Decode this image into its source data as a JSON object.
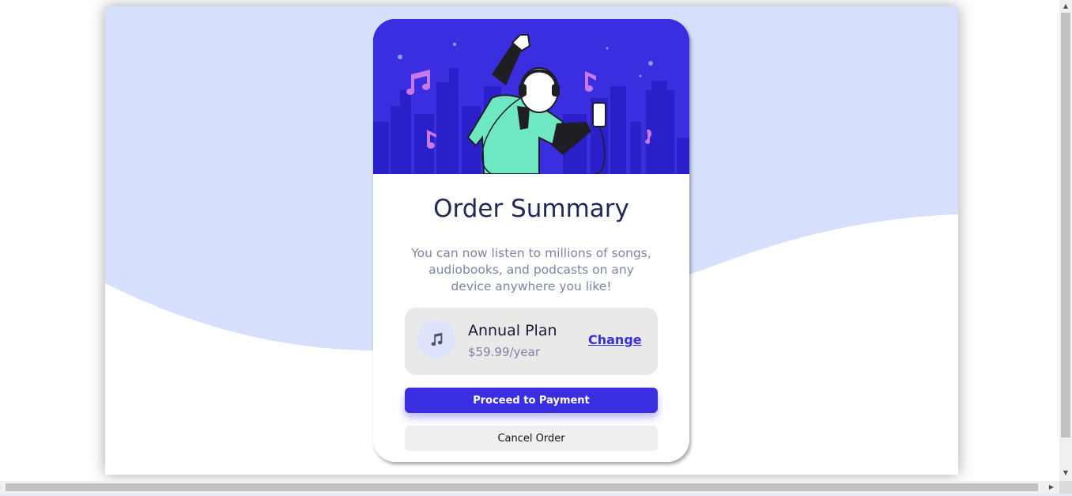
{
  "colors": {
    "background_wave": "#d6e0fd",
    "hero": "#3a2ee0",
    "primary": "#3a2ee0",
    "title": "#1f2b55",
    "muted": "#7c84a8"
  },
  "card": {
    "hero_image": "person-with-headphones-illustration",
    "title": "Order Summary",
    "description": "You can now listen to millions of songs, audiobooks, and podcasts on any device anywhere you like!",
    "plan": {
      "icon": "music-note-icon",
      "name": "Annual Plan",
      "price": "$59.99/year",
      "change_label": "Change"
    },
    "proceed_label": "Proceed to Payment",
    "cancel_label": "Cancel Order"
  },
  "scrollbars": {
    "up_arrow": "▲",
    "down_arrow": "▼",
    "left_arrow": "◀",
    "right_arrow": "▶"
  }
}
